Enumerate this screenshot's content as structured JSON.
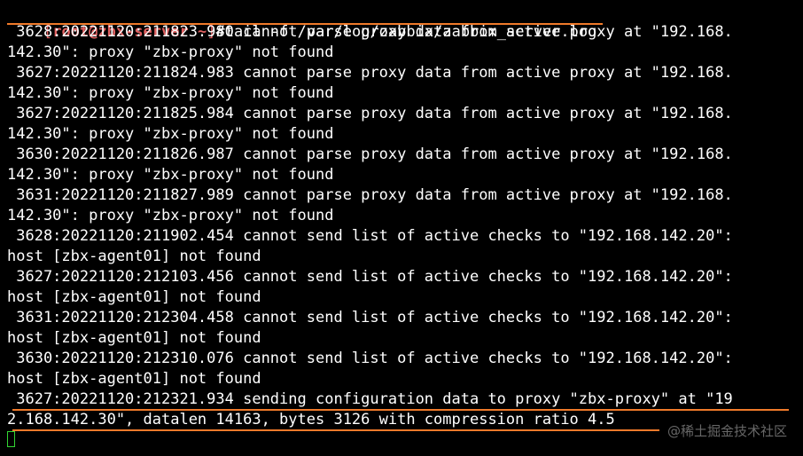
{
  "window": {
    "prompt": {
      "open_bracket": "[",
      "user_host": "root@zbx-server",
      "dir": " ~",
      "close_bracket": "]",
      "symbol": "#",
      "command": "tail -f /var/log/zabbix/zabbix_server.log"
    },
    "log_lines": [
      " 3628:20221120:211823.980 cannot parse proxy data from active proxy at \"192.168.",
      "142.30\": proxy \"zbx-proxy\" not found",
      " 3627:20221120:211824.983 cannot parse proxy data from active proxy at \"192.168.",
      "142.30\": proxy \"zbx-proxy\" not found",
      " 3627:20221120:211825.984 cannot parse proxy data from active proxy at \"192.168.",
      "142.30\": proxy \"zbx-proxy\" not found",
      " 3630:20221120:211826.987 cannot parse proxy data from active proxy at \"192.168.",
      "142.30\": proxy \"zbx-proxy\" not found",
      " 3631:20221120:211827.989 cannot parse proxy data from active proxy at \"192.168.",
      "142.30\": proxy \"zbx-proxy\" not found",
      " 3628:20221120:211902.454 cannot send list of active checks to \"192.168.142.20\":",
      "host [zbx-agent01] not found",
      " 3627:20221120:212103.456 cannot send list of active checks to \"192.168.142.20\":",
      "host [zbx-agent01] not found",
      " 3631:20221120:212304.458 cannot send list of active checks to \"192.168.142.20\":",
      "host [zbx-agent01] not found",
      " 3630:20221120:212310.076 cannot send list of active checks to \"192.168.142.20\":",
      "host [zbx-agent01] not found",
      " 3627:20221120:212321.934 sending configuration data to proxy \"zbx-proxy\" at \"19",
      "2.168.142.30\", datalen 14163, bytes 3126 with compression ratio 4.5"
    ],
    "watermark": "@稀土掘金技术社区",
    "colors": {
      "background": "#000000",
      "text": "#ffffff",
      "prompt": "#e06060",
      "highlight_underline": "#f07a2a",
      "cursor": "#33d633"
    }
  }
}
